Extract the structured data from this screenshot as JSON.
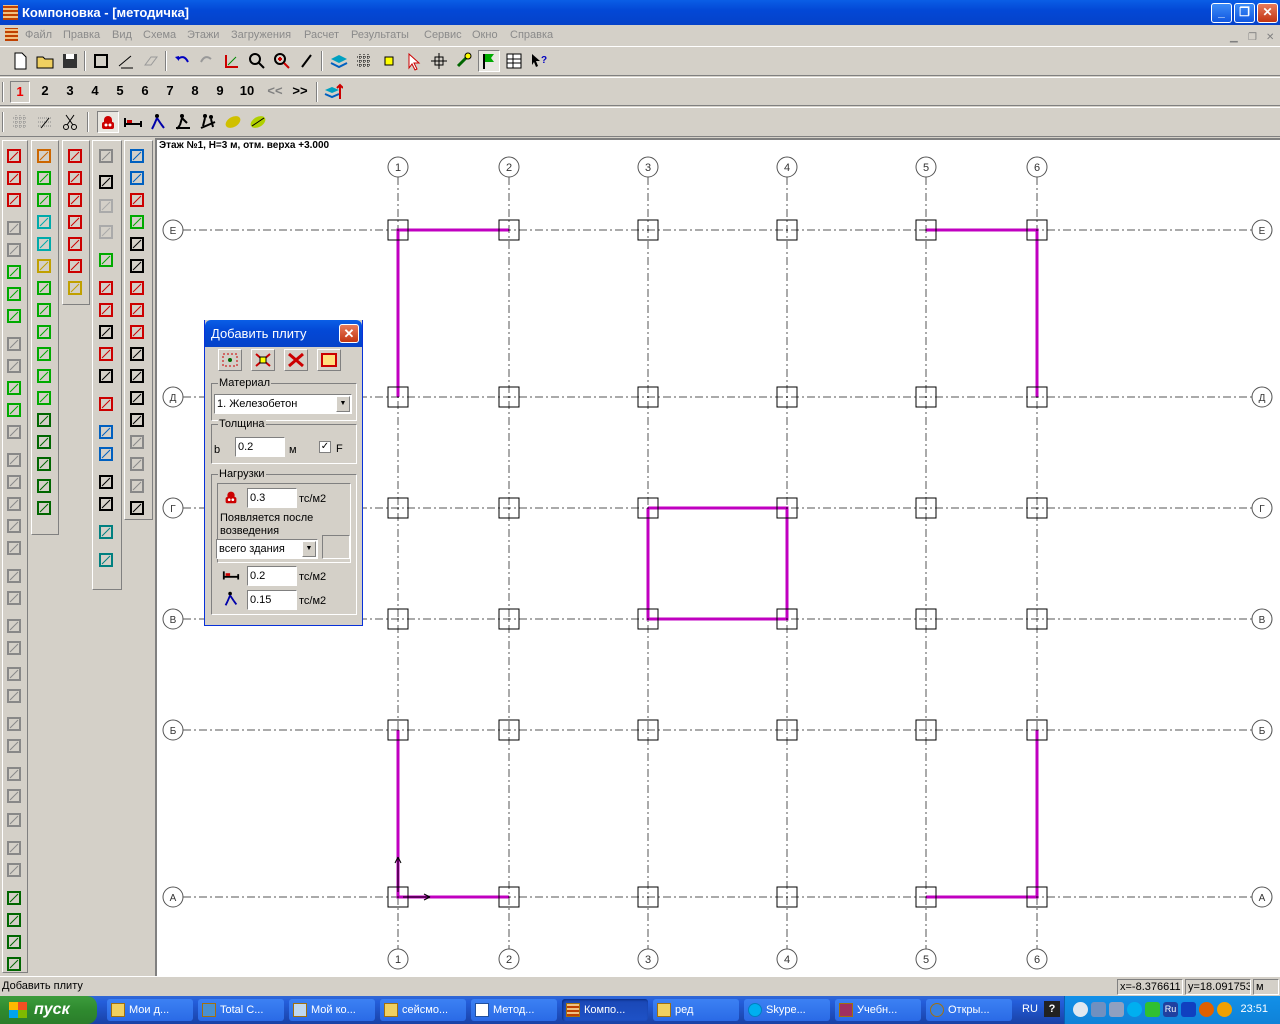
{
  "window": {
    "title": "Компоновка - [методичка]"
  },
  "menu": [
    "Файл",
    "Правка",
    "Вид",
    "Схема",
    "Этажи",
    "Загружения",
    "Расчет",
    "Результаты",
    "Сервис",
    "Окно",
    "Справка"
  ],
  "floors": {
    "items": [
      "1",
      "2",
      "3",
      "4",
      "5",
      "6",
      "7",
      "8",
      "9",
      "10"
    ],
    "active": "1",
    "prev": "<<",
    "next": ">>"
  },
  "canvas": {
    "floor_info": "Этаж №1, H=3 м, отм. верха +3.000",
    "axes_x": [
      "1",
      "2",
      "3",
      "4",
      "5",
      "6"
    ],
    "axes_y": [
      "Е",
      "Д",
      "Г",
      "В",
      "Б",
      "А"
    ],
    "slab_color": "#c000c0"
  },
  "dialog": {
    "title": "Добавить плиту",
    "material_label": "Материал",
    "material_value": "1. Железобетон",
    "thickness_label": "Толщина",
    "b_label": "b",
    "b_value": "0.2",
    "b_unit": "м",
    "f_checked": true,
    "f_label": "F",
    "loads_label": "Нагрузки",
    "load1_value": "0.3",
    "load_unit": "тс/м2",
    "appears_after": "Появляется после возведения",
    "appears_value": "всего здания",
    "load2_value": "0.2",
    "load3_value": "0.15"
  },
  "status": {
    "left": "Добавить плиту",
    "x": "x=-8.376611",
    "y": "y=18.091753",
    "unit": "м"
  },
  "taskbar": {
    "start": "пуск",
    "tasks": [
      "Мои д...",
      "Total C...",
      "Мой ко...",
      "сейсмо...",
      "Метод...",
      "Компо...",
      "ред",
      "Skype...",
      "Учебн...",
      "Откры..."
    ],
    "active_task": "Компо...",
    "lang": "RU",
    "clock": "23:51"
  }
}
